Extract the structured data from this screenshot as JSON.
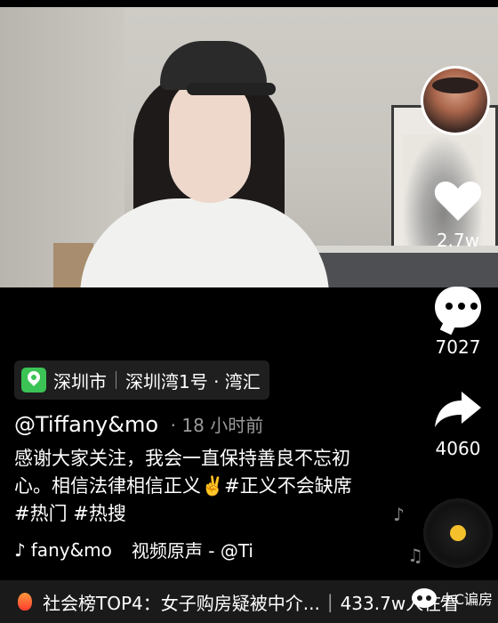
{
  "location": {
    "city": "深圳市",
    "place": "深圳湾1号 · 湾汇"
  },
  "author": {
    "handle": "@Tiffany&mo",
    "time": "· 18 小时前"
  },
  "caption": "感谢大家关注，我会一直保持善良不忘初心。相信法律相信正义✌️#正义不会缺席 #热门 #热搜",
  "actions": {
    "likes": "2.7w",
    "comments": "7027",
    "shares": "4060"
  },
  "music": {
    "icon": "tiktok-icon",
    "artist": "fany&mo",
    "track": "视频原声 - @Ti"
  },
  "hot_bar": {
    "text": "社会榜TOP4：女子购房疑被中介...",
    "count": "433.7w人在看"
  },
  "watermark": {
    "text": "小C谝房"
  }
}
